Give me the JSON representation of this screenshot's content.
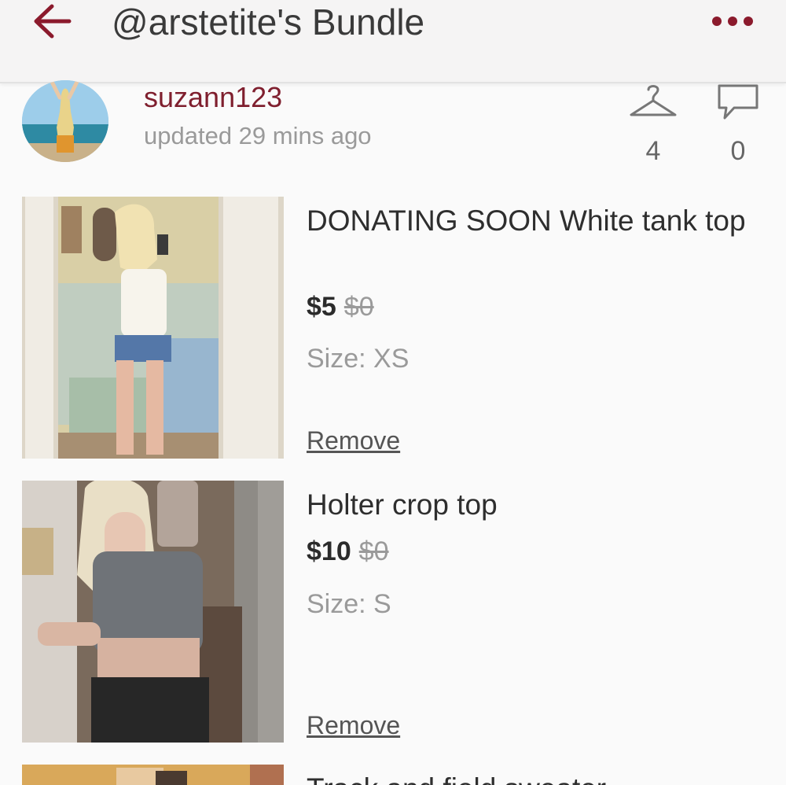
{
  "header": {
    "back_icon": "arrow-left-icon",
    "title": "@arstetite's Bundle",
    "more_icon": "more-horizontal-icon",
    "accent_color": "#8b1a2c"
  },
  "seller": {
    "username": "suzann123",
    "updated": "updated 29 mins ago",
    "likes_icon": "hanger-icon",
    "likes_count": "4",
    "comments_icon": "comment-icon",
    "comments_count": "0"
  },
  "items": [
    {
      "title": "DONATING SOON White tank top",
      "price": "$5",
      "original_price": "$0",
      "size": "Size: XS",
      "remove_label": "Remove"
    },
    {
      "title": "Holter crop top",
      "price": "$10",
      "original_price": "$0",
      "size": "Size: S",
      "remove_label": "Remove"
    },
    {
      "title": "Track and field sweater"
    }
  ]
}
